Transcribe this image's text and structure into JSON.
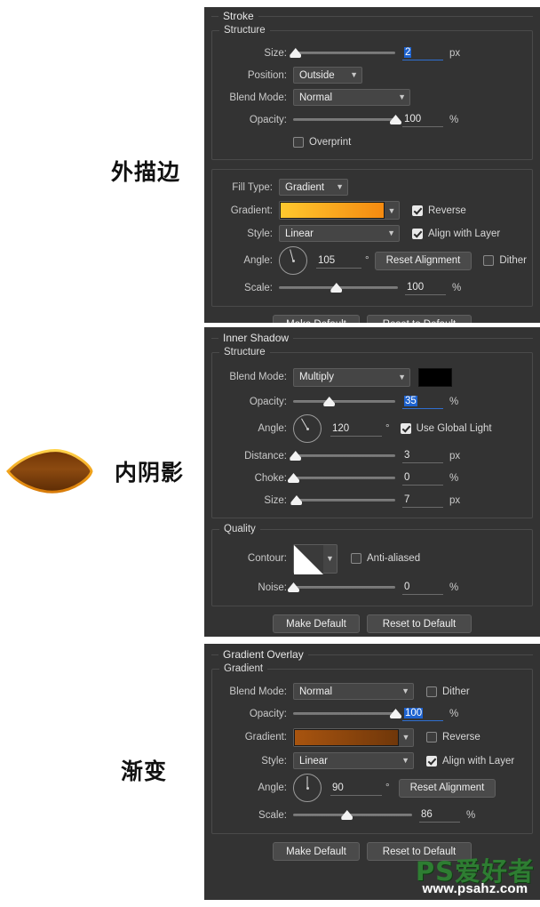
{
  "annotations": {
    "stroke_label": "外描边",
    "inner_shadow_label": "内阴影",
    "gradient_label": "渐变"
  },
  "watermark": {
    "brand": "PS爱好者",
    "url": "www.psahz.com"
  },
  "artwork": {
    "name": "leaf-shape-preview",
    "fill_start": "#7a3d08",
    "fill_end": "#8a4a10",
    "stroke_start": "#ffc82e",
    "stroke_end": "#f58a10"
  },
  "panels": [
    {
      "id": "stroke",
      "title": "Stroke",
      "sections": [
        {
          "title": "Structure"
        },
        {
          "title": ""
        }
      ],
      "size": {
        "label": "Size:",
        "value": "2",
        "unit": "px",
        "slider_percent": 2,
        "selected": true
      },
      "position": {
        "label": "Position:",
        "value": "Outside"
      },
      "blend_mode": {
        "label": "Blend Mode:",
        "value": "Normal"
      },
      "opacity": {
        "label": "Opacity:",
        "value": "100",
        "unit": "%",
        "slider_percent": 100
      },
      "overprint": {
        "label": "Overprint",
        "checked": false
      },
      "fill_type": {
        "label": "Fill Type:",
        "value": "Gradient"
      },
      "gradient": {
        "label": "Gradient:",
        "start": "#ffc82e",
        "end": "#f58a10"
      },
      "reverse": {
        "label": "Reverse",
        "checked": true
      },
      "style": {
        "label": "Style:",
        "value": "Linear"
      },
      "align_with_layer": {
        "label": "Align with Layer",
        "checked": true
      },
      "angle": {
        "label": "Angle:",
        "value": "105",
        "unit": "°"
      },
      "reset_alignment": "Reset Alignment",
      "dither": {
        "label": "Dither",
        "checked": false
      },
      "scale": {
        "label": "Scale:",
        "value": "100",
        "unit": "%",
        "slider_percent": 48
      },
      "make_default": "Make Default",
      "reset_to_default": "Reset to Default"
    },
    {
      "id": "inner-shadow",
      "title": "Inner Shadow",
      "structure_title": "Structure",
      "quality_title": "Quality",
      "blend_mode": {
        "label": "Blend Mode:",
        "value": "Multiply",
        "color": "#000000"
      },
      "opacity": {
        "label": "Opacity:",
        "value": "35",
        "unit": "%",
        "slider_percent": 35,
        "selected": true
      },
      "angle": {
        "label": "Angle:",
        "value": "120",
        "unit": "°"
      },
      "use_global_light": {
        "label": "Use Global Light",
        "checked": true
      },
      "distance": {
        "label": "Distance:",
        "value": "3",
        "unit": "px",
        "slider_percent": 2
      },
      "choke": {
        "label": "Choke:",
        "value": "0",
        "unit": "%",
        "slider_percent": 0
      },
      "size": {
        "label": "Size:",
        "value": "7",
        "unit": "px",
        "slider_percent": 3
      },
      "contour": {
        "label": "Contour:"
      },
      "anti_aliased": {
        "label": "Anti-aliased",
        "checked": false
      },
      "noise": {
        "label": "Noise:",
        "value": "0",
        "unit": "%",
        "slider_percent": 0
      },
      "make_default": "Make Default",
      "reset_to_default": "Reset to Default"
    },
    {
      "id": "gradient-overlay",
      "title": "Gradient Overlay",
      "section_title": "Gradient",
      "blend_mode": {
        "label": "Blend Mode:",
        "value": "Normal"
      },
      "dither": {
        "label": "Dither",
        "checked": false
      },
      "opacity": {
        "label": "Opacity:",
        "value": "100",
        "unit": "%",
        "slider_percent": 100,
        "selected": true
      },
      "gradient": {
        "label": "Gradient:",
        "start": "#a8540f",
        "end": "#70370a"
      },
      "reverse": {
        "label": "Reverse",
        "checked": false
      },
      "style": {
        "label": "Style:",
        "value": "Linear"
      },
      "align_with_layer": {
        "label": "Align with Layer",
        "checked": true
      },
      "angle": {
        "label": "Angle:",
        "value": "90",
        "unit": "°"
      },
      "reset_alignment": "Reset Alignment",
      "scale": {
        "label": "Scale:",
        "value": "86",
        "unit": "%",
        "slider_percent": 45
      },
      "make_default": "Make Default",
      "reset_to_default": "Reset to Default"
    }
  ]
}
